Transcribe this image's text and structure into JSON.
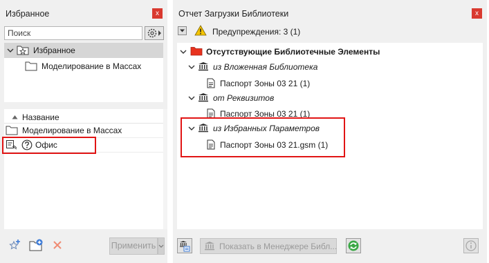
{
  "left_panel": {
    "title": "Избранное",
    "close_glyph": "x",
    "search_placeholder": "Поиск",
    "tree": {
      "root_label": "Избранное",
      "child_label": "Моделирование в Массах"
    },
    "list": {
      "column_header": "Название",
      "rows": [
        {
          "label": "Моделирование в Массах",
          "icon": "folder-icon"
        },
        {
          "label": "Офис",
          "icon": "missing-item-icon"
        }
      ]
    },
    "footer": {
      "apply_label": "Применить"
    }
  },
  "right_panel": {
    "title": "Отчет Загрузки Библиотеки",
    "close_glyph": "x",
    "warnings_label": "Предупреждения: 3 (1)",
    "tree": {
      "root_label": "Отсутствующие Библиотечные Элементы",
      "groups": [
        {
          "label": "из Вложенная Библиотека",
          "item": "Паспорт Зоны 03 21 (1)"
        },
        {
          "label": "от Реквизитов",
          "item": "Паспорт Зоны 03 21 (1)"
        },
        {
          "label": "из Избранных Параметров",
          "item": "Паспорт Зоны 03 21.gsm (1)"
        }
      ]
    },
    "footer": {
      "show_in_manager_label": "Показать в Менеджере Библ..."
    }
  },
  "colors": {
    "highlight": "#e11414",
    "close_button": "#d9392f",
    "missing_folder": "#e8321e",
    "warning": "#f5c400"
  }
}
